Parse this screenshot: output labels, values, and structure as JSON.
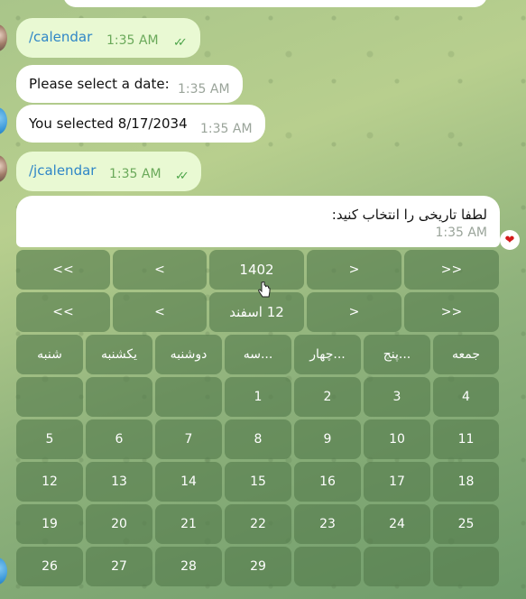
{
  "messages": [
    {
      "id": "m1",
      "dir": "out",
      "text": "/calendar",
      "time": "1:35 AM",
      "read": true
    },
    {
      "id": "m2",
      "dir": "in",
      "text": "Please select a date:",
      "time": "1:35 AM"
    },
    {
      "id": "m3",
      "dir": "in",
      "text": "You selected 8/17/2034",
      "time": "1:35 AM"
    },
    {
      "id": "m4",
      "dir": "out",
      "text": "/jcalendar",
      "time": "1:35 AM",
      "read": true
    },
    {
      "id": "m5",
      "dir": "in",
      "text": "لطفا تاریخی را انتخاب کنید:",
      "time": "1:35 AM",
      "reaction": "heart"
    }
  ],
  "keyboard": {
    "year_row": [
      "<<",
      "<",
      "1402",
      ">",
      ">>"
    ],
    "month_row": [
      "<<",
      "<",
      "12 اسفند",
      ">",
      ">>"
    ],
    "weekdays": [
      "جمعه",
      "پنج...",
      "چهار...",
      "سه...",
      "دوشنبه",
      "یکشنبه",
      "شنبه"
    ],
    "weeks": [
      [
        "4",
        "3",
        "2",
        "1",
        "",
        "",
        ""
      ],
      [
        "11",
        "10",
        "9",
        "8",
        "7",
        "6",
        "5"
      ],
      [
        "18",
        "17",
        "16",
        "15",
        "14",
        "13",
        "12"
      ],
      [
        "25",
        "24",
        "23",
        "22",
        "21",
        "20",
        "19"
      ],
      [
        "",
        "",
        "",
        "29",
        "28",
        "27",
        "26"
      ]
    ]
  },
  "colors": {
    "outgoing_bubble": "#e9f9d3",
    "incoming_bubble": "#ffffff",
    "keyboard_button": "#547a4c",
    "read_ticks": "#4da44a",
    "heart": "#d31b1b"
  }
}
